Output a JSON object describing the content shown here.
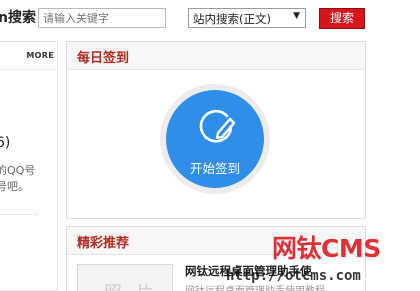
{
  "search": {
    "title": "n搜索",
    "placeholder": "请输入关键字",
    "scope_selected": "站内搜索(正文)",
    "button_label": "搜索"
  },
  "left": {
    "more_label": "MORE",
    "count_text": "6)",
    "desc_line1": "的QQ号",
    "desc_line2": "号吧。"
  },
  "checkin": {
    "title": "每日签到",
    "button_label": "开始签到",
    "icon": "edit-checkin-icon",
    "accent_color": "#2f8ee8"
  },
  "recommend": {
    "title": "精彩推荐",
    "item_thumb_text": "照片",
    "item_title": "网钛远程桌面管理助手使",
    "item_desc": "网钛远程桌面管理助手使用教程"
  },
  "watermark": {
    "logo": "网钛CMS",
    "url": "http://otcms.com"
  },
  "colors": {
    "brand_red": "#d5151b",
    "heading_red": "#b52a1f"
  }
}
